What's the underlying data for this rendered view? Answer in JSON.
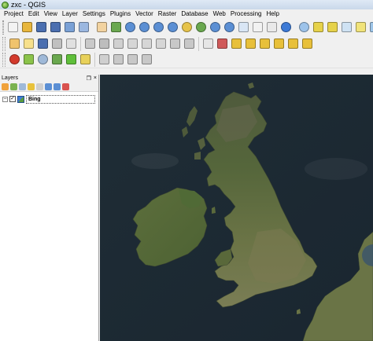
{
  "window": {
    "title": "zxc - QGIS"
  },
  "menu": [
    "Project",
    "Edit",
    "View",
    "Layer",
    "Settings",
    "Plugins",
    "Vector",
    "Raster",
    "Database",
    "Web",
    "Processing",
    "Help"
  ],
  "toolbars": {
    "row1": [
      {
        "name": "new-project-icon",
        "color": "#f3f3f3"
      },
      {
        "name": "open-project-icon",
        "color": "#e8b63c"
      },
      {
        "name": "save-project-icon",
        "color": "#4b6fb0"
      },
      {
        "name": "save-as-icon",
        "color": "#4b6fb0"
      },
      {
        "name": "print-composer-icon",
        "color": "#7aa1d6"
      },
      {
        "name": "composer-manager-icon",
        "color": "#9bb7e0"
      },
      {
        "name": "sep"
      },
      {
        "name": "pan-hand-icon",
        "color": "#f2d3a0"
      },
      {
        "name": "pan-to-selection-icon",
        "color": "#6aa84f"
      },
      {
        "name": "zoom-in-icon",
        "color": "#5b8fd4"
      },
      {
        "name": "zoom-out-icon",
        "color": "#5b8fd4"
      },
      {
        "name": "zoom-actual-icon",
        "color": "#5b8fd4"
      },
      {
        "name": "zoom-full-icon",
        "color": "#5b8fd4"
      },
      {
        "name": "zoom-selection-icon",
        "color": "#e6c34a"
      },
      {
        "name": "zoom-layer-icon",
        "color": "#6aa84f"
      },
      {
        "name": "zoom-last-icon",
        "color": "#5b8fd4"
      },
      {
        "name": "zoom-next-icon",
        "color": "#5b8fd4"
      },
      {
        "name": "new-map-view-icon",
        "color": "#d9e6f5"
      },
      {
        "name": "bookmark-icon",
        "color": "#f2f2f2"
      },
      {
        "name": "show-bookmarks-icon",
        "color": "#e9e9e9"
      },
      {
        "name": "refresh-icon",
        "color": "#3d7ad6"
      },
      {
        "name": "sep"
      },
      {
        "name": "identify-icon",
        "color": "#9dc3ea"
      },
      {
        "name": "select-features-icon",
        "color": "#e6d24a"
      },
      {
        "name": "deselect-icon",
        "color": "#e6d24a"
      },
      {
        "name": "field-calculator-icon",
        "color": "#cfe2f3"
      },
      {
        "name": "measure-icon",
        "color": "#f1e37a"
      },
      {
        "name": "statistics-icon",
        "color": "#9ec5e8"
      },
      {
        "name": "map-tips-icon",
        "color": "#fff2a8"
      },
      {
        "name": "text-annotation-icon",
        "color": "#ffe37a"
      },
      {
        "name": "delete-icon",
        "color": "#d9534f"
      }
    ],
    "row2": [
      {
        "name": "current-edits-icon",
        "color": "#f0c36d"
      },
      {
        "name": "toggle-editing-icon",
        "color": "#f7e08b"
      },
      {
        "name": "save-edits-icon",
        "color": "#4b6fb0"
      },
      {
        "name": "digitize-icon",
        "color": "#c0c0c0"
      },
      {
        "name": "add-feature-icon",
        "color": "#e0e0e0"
      },
      {
        "name": "sep"
      },
      {
        "name": "move-feature-icon",
        "color": "#c9c9c9"
      },
      {
        "name": "node-tool-icon",
        "color": "#bdbdbd"
      },
      {
        "name": "delete-selected-icon",
        "color": "#d0d0d0"
      },
      {
        "name": "cut-features-icon",
        "color": "#d6d6d6"
      },
      {
        "name": "copy-features-icon",
        "color": "#d6d6d6"
      },
      {
        "name": "paste-features-icon",
        "color": "#d6d6d6"
      },
      {
        "name": "undo-icon",
        "color": "#c8c8c8"
      },
      {
        "name": "redo-icon",
        "color": "#c8c8c8"
      },
      {
        "name": "sep"
      },
      {
        "name": "label-icon",
        "color": "#e6e6e6"
      },
      {
        "name": "label-pin-icon",
        "color": "#d05a5a"
      },
      {
        "name": "label-highlight-icon",
        "color": "#e8c03a"
      },
      {
        "name": "label-move-icon",
        "color": "#e8c03a"
      },
      {
        "name": "label-rotate-icon",
        "color": "#e8c03a"
      },
      {
        "name": "label-change-icon",
        "color": "#e8c03a"
      },
      {
        "name": "label-show-icon",
        "color": "#e8c03a"
      },
      {
        "name": "label-diagram-icon",
        "color": "#e8c03a"
      }
    ],
    "row3": [
      {
        "name": "snapping-magnet-icon",
        "color": "#d33a2c"
      },
      {
        "name": "trace-icon",
        "color": "#8bc34a"
      },
      {
        "name": "eye-visibility-icon",
        "color": "#9fb9d8"
      },
      {
        "name": "vertex-icon",
        "color": "#6aa84f"
      },
      {
        "name": "topology-icon",
        "color": "#5fbf3a"
      },
      {
        "name": "cad-tool-icon",
        "color": "#e8d15a"
      },
      {
        "name": "sep"
      },
      {
        "name": "rotate-point-icon",
        "color": "#cfcfcf"
      },
      {
        "name": "simplify-icon",
        "color": "#c8c8c8"
      },
      {
        "name": "offset-curve-icon",
        "color": "#c8c8c8"
      },
      {
        "name": "reshape-icon",
        "color": "#c8c8c8"
      }
    ]
  },
  "layers_panel": {
    "title": "Layers",
    "float_label": "❐",
    "close_label": "×",
    "layers": [
      {
        "name": "Bing",
        "checked": true,
        "expanded": false
      }
    ]
  },
  "map": {
    "background": "Bing aerial imagery of Great Britain and Ireland"
  }
}
